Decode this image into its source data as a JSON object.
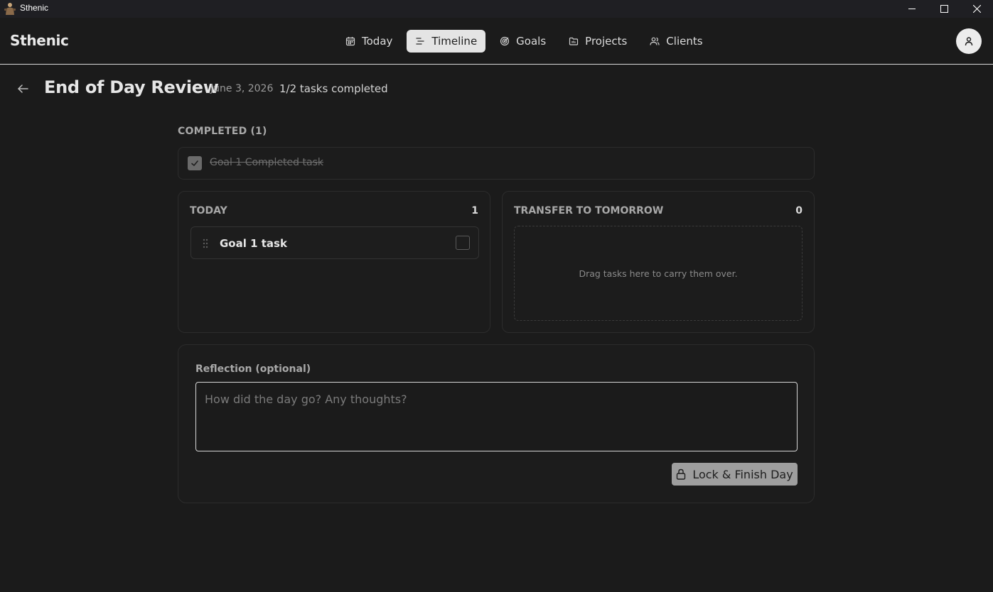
{
  "window": {
    "title": "Sthenic",
    "controls": [
      "minimize-icon",
      "maximize-icon",
      "close-icon"
    ]
  },
  "header": {
    "brand": "Sthenic",
    "nav": [
      {
        "label": "Today",
        "icon": "calendar-icon",
        "active": false
      },
      {
        "label": "Timeline",
        "icon": "timeline-icon",
        "active": true
      },
      {
        "label": "Goals",
        "icon": "target-icon",
        "active": false
      },
      {
        "label": "Projects",
        "icon": "folder-icon",
        "active": false
      },
      {
        "label": "Clients",
        "icon": "users-icon",
        "active": false
      }
    ],
    "avatar_icon": "user-icon"
  },
  "page": {
    "title": "End of Day Review",
    "date": "June 3, 2026",
    "progress": "1/2 tasks completed"
  },
  "completed": {
    "label": "COMPLETED (1)",
    "items": [
      {
        "text": "Goal 1 Completed task",
        "checked": true
      }
    ]
  },
  "today": {
    "title": "TODAY",
    "count": "1",
    "items": [
      {
        "text": "Goal 1 task",
        "checked": false
      }
    ]
  },
  "transfer": {
    "title": "TRANSFER TO TOMORROW",
    "count": "0",
    "empty_text": "Drag tasks here to carry them over."
  },
  "reflection": {
    "label": "Reflection (optional)",
    "placeholder": "How did the day go? Any thoughts?",
    "value": ""
  },
  "actions": {
    "lock_label": "Lock & Finish Day",
    "lock_icon": "lock-icon"
  },
  "colors": {
    "background": "#1b1b1b",
    "active_nav": "#e4e4e4",
    "button": "#9e9e9e"
  }
}
